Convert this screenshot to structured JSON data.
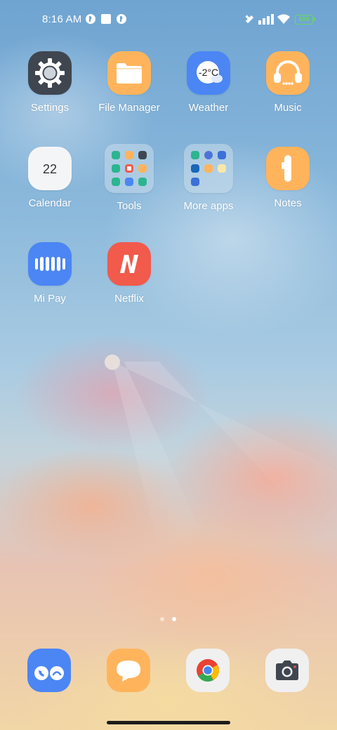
{
  "status_bar": {
    "time": "8:16 AM",
    "battery": "100"
  },
  "apps": {
    "settings": "Settings",
    "file_manager": "File Manager",
    "weather": "Weather",
    "weather_temp": "-2°C",
    "music": "Music",
    "calendar": "Calendar",
    "calendar_day": "22",
    "tools": "Tools",
    "more_apps": "More apps",
    "notes": "Notes",
    "mi_pay": "Mi Pay",
    "netflix": "Netflix"
  },
  "colors": {
    "settings_bg": "#3f4650",
    "orange": "#ffb45c",
    "blue": "#4b86f4",
    "netflix_red": "#f25a4b",
    "battery_green": "#6cd46a"
  },
  "page_indicator": {
    "pages": 2,
    "current": 2
  },
  "dock": [
    "phone-icon",
    "messages-icon",
    "chrome-icon",
    "camera-icon"
  ]
}
